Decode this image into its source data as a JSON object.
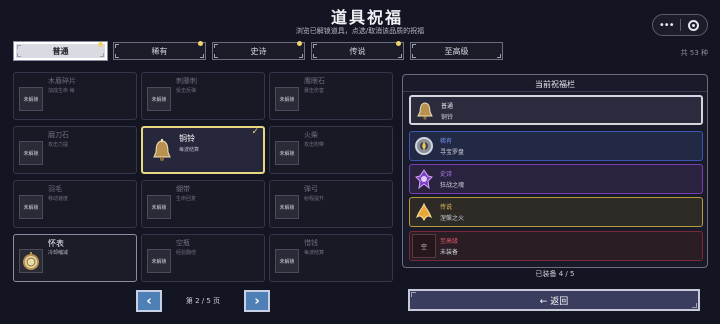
{
  "header": {
    "back_icon": "",
    "title": "道具祝福",
    "subtitle": "浏览已解锁道具，点选/取消该品质的祝福",
    "menu_icon": "•••",
    "target_icon": "target-icon"
  },
  "tabs": [
    {
      "label": "普通",
      "active": true
    },
    {
      "label": "稀有",
      "active": false
    },
    {
      "label": "史诗",
      "active": false
    },
    {
      "label": "传说",
      "active": false
    },
    {
      "label": "至高级",
      "active": false
    }
  ],
  "total_count": "共 53 种",
  "items": [
    {
      "name": "木盾碎片",
      "desc": "加成生命 每",
      "lock": "未解锁",
      "state": "locked"
    },
    {
      "name": "刺藤刺",
      "desc": "受击反弹",
      "lock": "未解锁",
      "state": "locked"
    },
    {
      "name": "鹰眼石",
      "desc": "暴击伤害",
      "lock": "未解锁",
      "state": "locked"
    },
    {
      "name": "磨刀石",
      "desc": "攻击力提",
      "lock": "未解锁",
      "state": "locked"
    },
    {
      "name": "铜铃",
      "desc": "每波结算",
      "lock": "",
      "state": "selected",
      "check": "✓"
    },
    {
      "name": "火柴",
      "desc": "攻击附带",
      "lock": "未解锁",
      "state": "locked"
    },
    {
      "name": "羽毛",
      "desc": "移动速度",
      "lock": "未解锁",
      "state": "locked"
    },
    {
      "name": "绷带",
      "desc": "生命回复",
      "lock": "未解锁",
      "state": "locked"
    },
    {
      "name": "弹弓",
      "desc": "射程提升",
      "lock": "未解锁",
      "state": "locked"
    },
    {
      "name": "怀表",
      "desc": "冷却缩减",
      "lock": "",
      "state": "unlocked"
    },
    {
      "name": "空瓶",
      "desc": "经验翻倍",
      "lock": "未解锁",
      "state": "locked"
    },
    {
      "name": "惜钱",
      "desc": "每波结算",
      "lock": "未解锁",
      "state": "locked"
    }
  ],
  "pager": {
    "prev": "‹",
    "next": "›",
    "text": "第 2 / 5 页"
  },
  "panel": {
    "title": "当前祝福栏",
    "slots": [
      {
        "tier": "普通",
        "name": "铜铃",
        "tier_color": "#e6e6ee"
      },
      {
        "tier": "稀有",
        "name": "寻宝罗盘",
        "tier_color": "#6f8ee8"
      },
      {
        "tier": "史诗",
        "name": "狂战之魂",
        "tier_color": "#b27ee8"
      },
      {
        "tier": "传说",
        "name": "涅槃之火",
        "tier_color": "#e8c45c"
      },
      {
        "tier": "至高级",
        "name": "未装备",
        "tier_color": "#e05a6a",
        "empty_icon": "空"
      }
    ],
    "equip_count": "已装备 4 / 5"
  },
  "return_label": "← 返回"
}
